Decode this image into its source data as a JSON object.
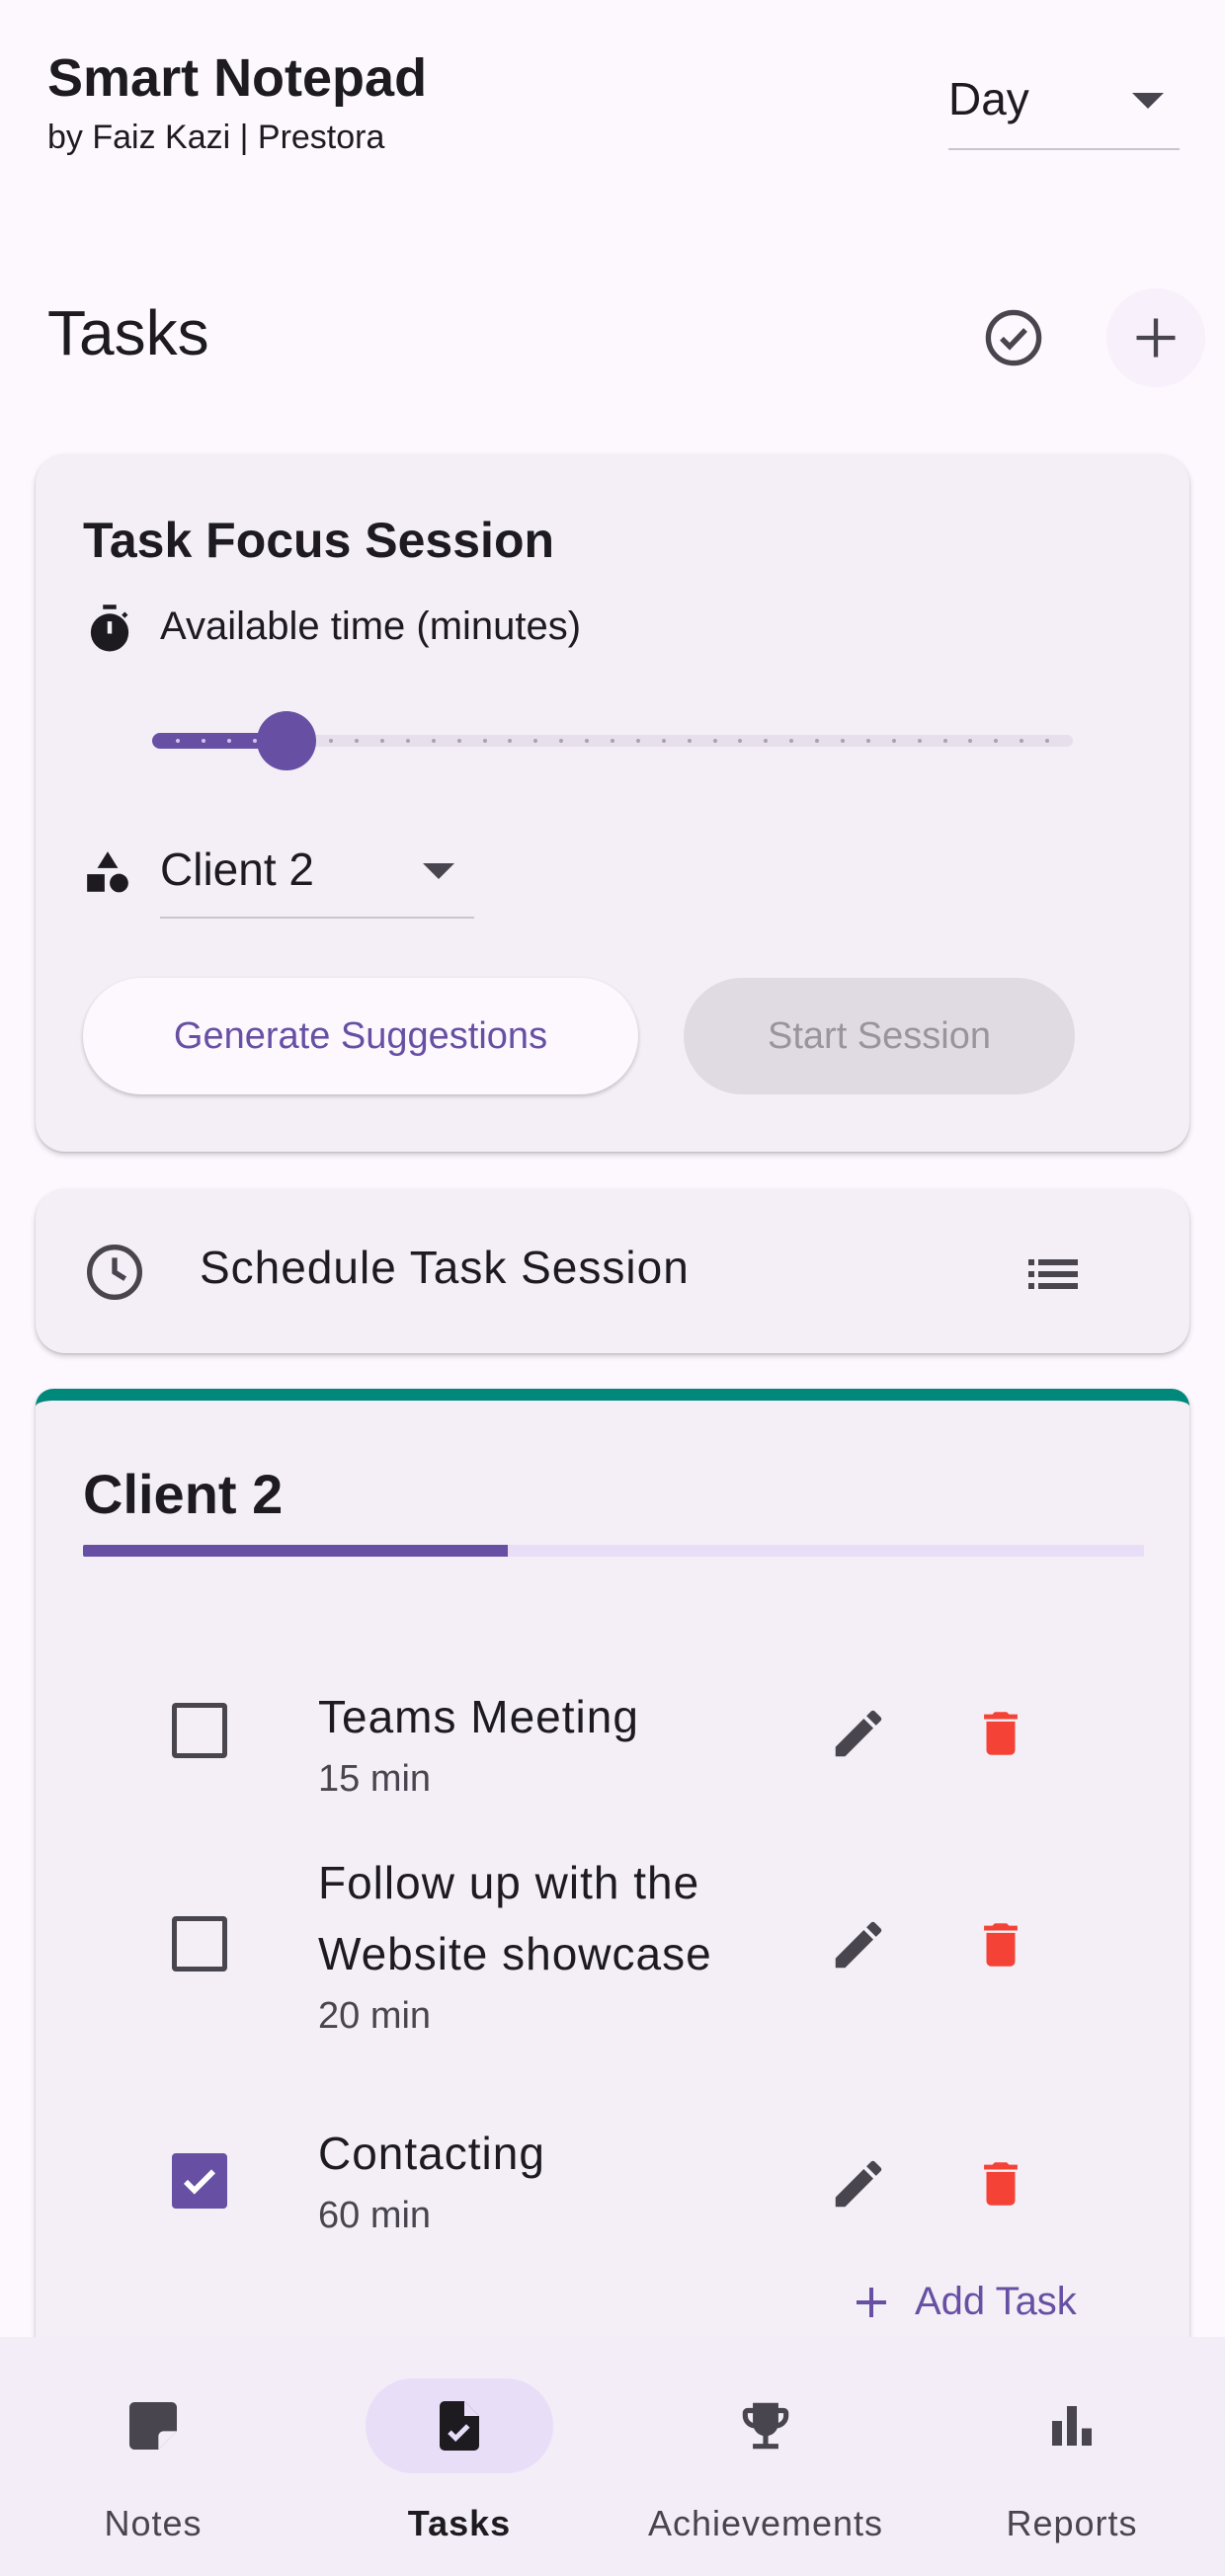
{
  "app": {
    "title": "Smart Notepad",
    "subtitle": "by Faiz Kazi | Prestora",
    "view_select": "Day"
  },
  "section": {
    "title": "Tasks"
  },
  "focus_session": {
    "title": "Task Focus Session",
    "available_time_label": "Available time (minutes)",
    "slider_fraction": 0.146,
    "slider_divisions": 36,
    "category": "Client 2",
    "generate_label": "Generate Suggestions",
    "start_label": "Start Session"
  },
  "schedule": {
    "label": "Schedule Task Session"
  },
  "client_group": {
    "title": "Client 2",
    "accent_color": "#00897b",
    "progress_fraction": 0.4,
    "tasks": [
      {
        "title": "Teams Meeting",
        "duration": "15 min",
        "done": false
      },
      {
        "title": "Follow up with the Website showcase",
        "duration": "20 min",
        "done": false
      },
      {
        "title": "Contacting",
        "duration": "60 min",
        "done": true
      }
    ],
    "add_task_label": "Add Task"
  },
  "nav": {
    "items": [
      {
        "label": "Notes",
        "icon": "note-icon",
        "active": false
      },
      {
        "label": "Tasks",
        "icon": "task-check-icon",
        "active": true
      },
      {
        "label": "Achievements",
        "icon": "trophy-icon",
        "active": false
      },
      {
        "label": "Reports",
        "icon": "bar-chart-icon",
        "active": false
      }
    ]
  },
  "colors": {
    "primary": "#6750a4",
    "delete": "#f44336",
    "background": "#fdf7fe"
  }
}
